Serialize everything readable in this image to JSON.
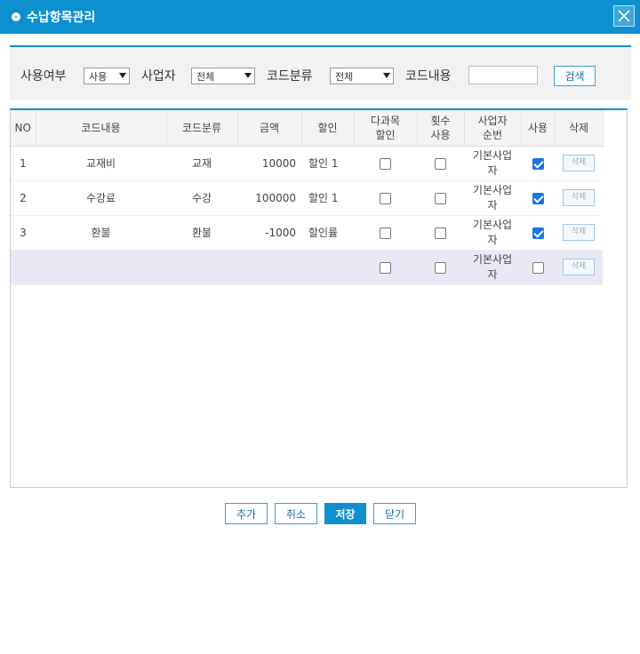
{
  "window": {
    "title": "수납항목관리",
    "close_icon": "close-icon",
    "accent_color": "#0d8fd0"
  },
  "search": {
    "use_label": "사용여부",
    "use_value": "사용",
    "business_label": "사업자",
    "business_value": "전체",
    "category_label": "코드분류",
    "category_value": "전체",
    "content_label": "코드내용",
    "content_value": "",
    "search_button": "검색"
  },
  "table": {
    "headers": {
      "no": "NO",
      "content": "코드내용",
      "category": "코드분류",
      "amount": "금액",
      "discount": "할인",
      "multi_course_1": "다과목",
      "multi_course_2": "할인",
      "count_use_1": "횟수",
      "count_use_2": "사용",
      "biz_order_1": "사업자",
      "biz_order_2": "순번",
      "use": "사용",
      "delete": "삭제"
    },
    "rows": [
      {
        "no": "1",
        "content": "교재비",
        "category": "교재",
        "amount": "10000",
        "discount": "할인 1",
        "multi": false,
        "count": false,
        "biz_1": "기본사업",
        "biz_2": "자",
        "use": true,
        "delete": "삭제"
      },
      {
        "no": "2",
        "content": "수강료",
        "category": "수강",
        "amount": "100000",
        "discount": "할인 1",
        "multi": false,
        "count": false,
        "biz_1": "기본사업",
        "biz_2": "자",
        "use": true,
        "delete": "삭제"
      },
      {
        "no": "3",
        "content": "환불",
        "category": "환불",
        "amount": "-1000",
        "discount": "할인률",
        "multi": false,
        "count": false,
        "biz_1": "기본사업",
        "biz_2": "자",
        "use": true,
        "delete": "삭제"
      },
      {
        "no": "",
        "content": "",
        "category": "",
        "amount": "",
        "discount": "",
        "multi": false,
        "count": false,
        "biz_1": "기본사업",
        "biz_2": "자",
        "use": false,
        "delete": "삭제"
      }
    ]
  },
  "footer": {
    "add": "추가",
    "cancel": "취소",
    "save": "저장",
    "close": "닫기"
  }
}
